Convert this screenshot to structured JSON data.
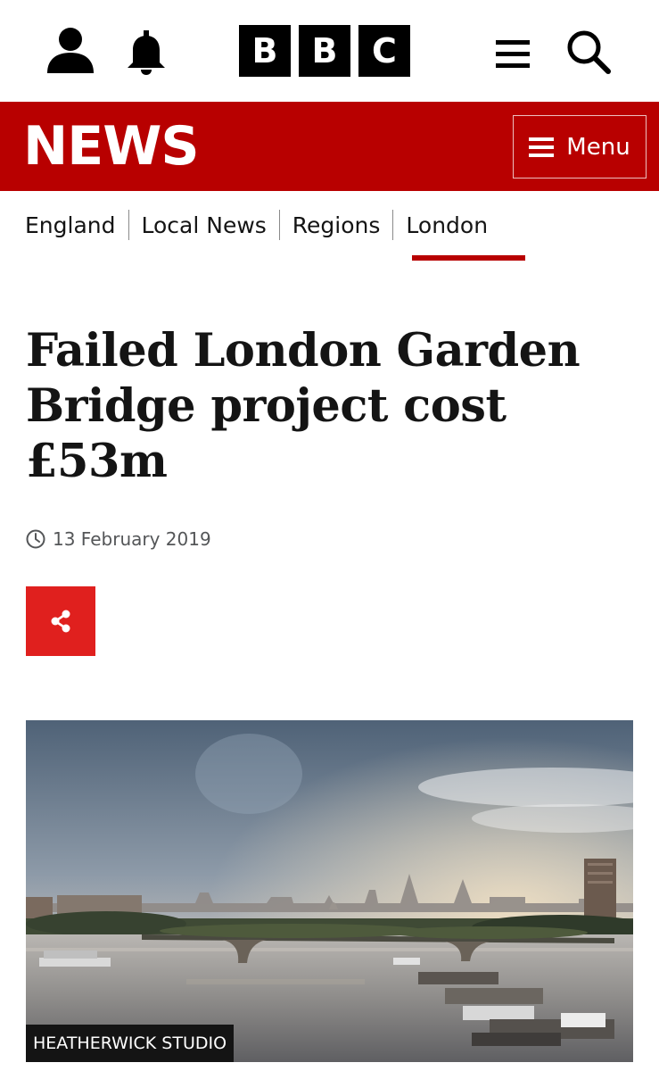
{
  "header": {
    "brand_letters": [
      "B",
      "B",
      "C"
    ],
    "icons": [
      "account-icon",
      "notifications-bell-icon",
      "hamburger-icon",
      "search-icon"
    ]
  },
  "newsbar": {
    "title": "NEWS",
    "menu_label": "Menu",
    "color": "#b80000"
  },
  "breadcrumb": {
    "items": [
      "England",
      "Local News",
      "Regions",
      "London"
    ],
    "active": "London"
  },
  "article": {
    "headline": "Failed London Garden Bridge project cost £53m",
    "date": "13 February 2019",
    "image_credit": "HEATHERWICK STUDIO"
  },
  "colors": {
    "accent_red": "#b80000",
    "share_red": "#e0201e",
    "text": "#141414",
    "muted": "#545658"
  }
}
